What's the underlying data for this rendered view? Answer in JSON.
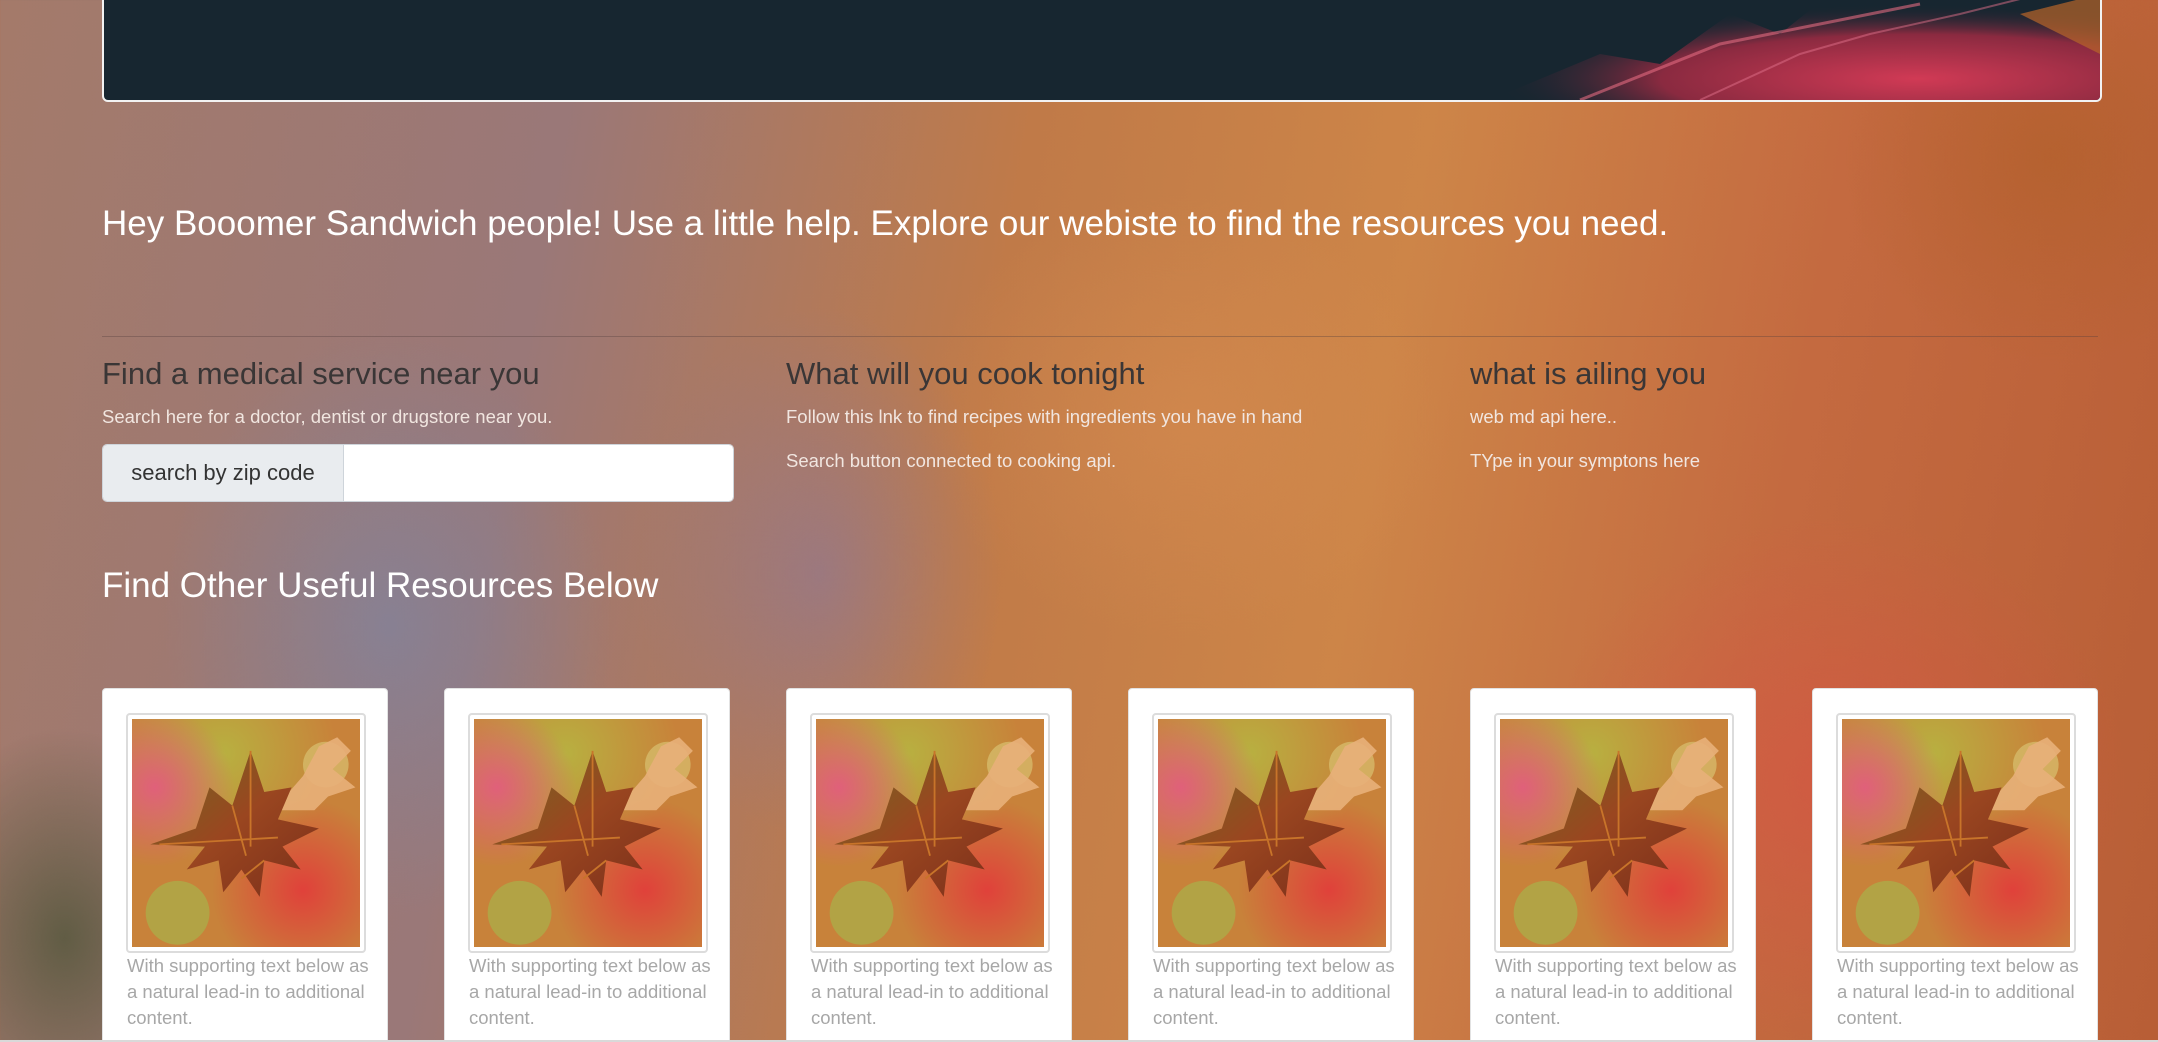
{
  "welcome": "Hey Booomer Sandwich people! Use a little help. Explore our webiste to find the resources you need.",
  "columns": [
    {
      "title": "Find a medical service near you",
      "text": "Search here for a doctor, dentist or drugstore near you.",
      "text2": ""
    },
    {
      "title": "What will you cook tonight",
      "text": "Follow this lnk to find recipes with ingredients you have in hand",
      "text2": "Search button connected to cooking api."
    },
    {
      "title": "what is ailing you",
      "text": "web md api here..",
      "text2": "TYpe in your symptons here"
    }
  ],
  "zip_search": {
    "addon_label": "search by zip code",
    "value": ""
  },
  "resources_title": "Find Other Useful Resources Below",
  "cards": [
    {
      "text": "With supporting text below as a natural lead-in to additional content."
    },
    {
      "text": "With supporting text below as a natural lead-in to additional content."
    },
    {
      "text": "With supporting text below as a natural lead-in to additional content."
    },
    {
      "text": "With supporting text below as a natural lead-in to additional content."
    },
    {
      "text": "With supporting text below as a natural lead-in to additional content."
    },
    {
      "text": "With supporting text below as a natural lead-in to additional content."
    }
  ],
  "colors": {
    "hero_bg": "#172630",
    "text_light": "#ffffff",
    "heading_dark": "#3a3636"
  }
}
